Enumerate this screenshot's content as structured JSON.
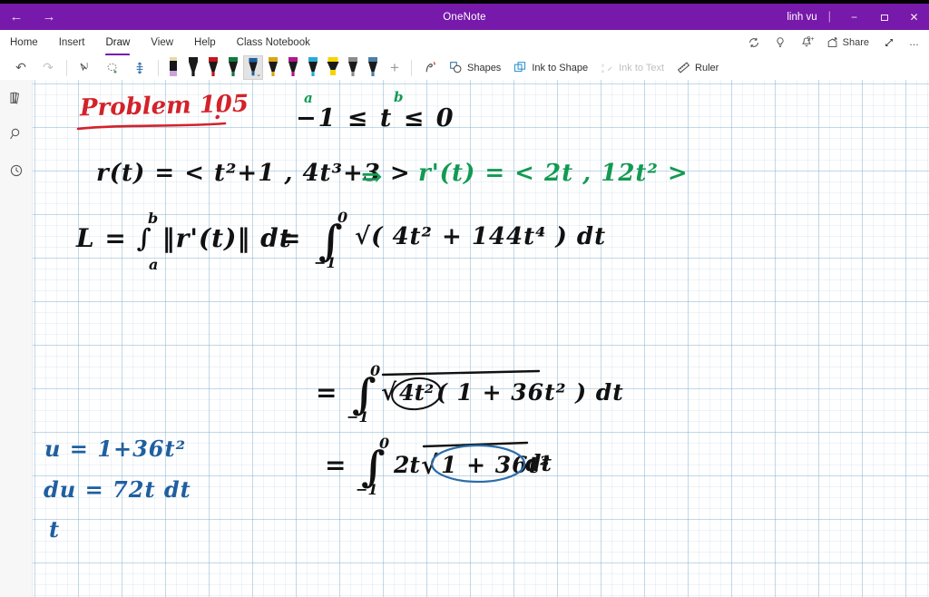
{
  "window": {
    "title": "OneNote",
    "user": "linh vu",
    "back_label": "←",
    "forward_label": "→",
    "minimize_label": "−",
    "restore_label": "❐",
    "close_label": "✕",
    "accent_color": "#7719AA"
  },
  "menu": {
    "items": [
      {
        "label": "Home",
        "active": false
      },
      {
        "label": "Insert",
        "active": false
      },
      {
        "label": "Draw",
        "active": true
      },
      {
        "label": "View",
        "active": false
      },
      {
        "label": "Help",
        "active": false
      },
      {
        "label": "Class Notebook",
        "active": false
      }
    ],
    "right_items": [
      {
        "name": "sync-icon",
        "label": ""
      },
      {
        "name": "tell-me-lightbulb-icon",
        "label": ""
      },
      {
        "name": "notifications-bell-icon",
        "label": "",
        "badge": "9+"
      },
      {
        "name": "share-icon",
        "label": "Share"
      },
      {
        "name": "full-screen-icon",
        "label": ""
      },
      {
        "name": "more-options-icon",
        "label": "…"
      }
    ]
  },
  "ribbon": {
    "undo_label": "↶",
    "redo_label": "↷",
    "tools": [
      {
        "name": "text-select-tool",
        "label": ""
      },
      {
        "name": "lasso-select-tool",
        "label": ""
      },
      {
        "name": "panning-hand-tool",
        "label": ""
      }
    ],
    "pens": [
      {
        "name": "pen-eraser-lavender",
        "color": "#cba3d8",
        "cap": "#e8d8a8",
        "type": "eraser",
        "selected": false
      },
      {
        "name": "pen-black",
        "color": "#1a1a1a",
        "cap": "#1a1a1a",
        "type": "pen",
        "selected": false
      },
      {
        "name": "pen-red",
        "color": "#c4161c",
        "cap": "#c4161c",
        "type": "pen",
        "selected": false
      },
      {
        "name": "pen-green",
        "color": "#0e7a3c",
        "cap": "#0e7a3c",
        "type": "pen",
        "selected": false
      },
      {
        "name": "pen-blue",
        "color": "#1f5fa0",
        "cap": "#1f5fa0",
        "type": "pen",
        "selected": true
      },
      {
        "name": "pen-gold",
        "color": "#d9a514",
        "cap": "#d9a514",
        "type": "pen",
        "selected": false
      },
      {
        "name": "pen-magenta",
        "color": "#b0168e",
        "cap": "#b0168e",
        "type": "pen",
        "selected": false
      },
      {
        "name": "pen-cyan",
        "color": "#2aa9dd",
        "cap": "#2aa9dd",
        "type": "pen",
        "selected": false
      },
      {
        "name": "highlighter-yellow",
        "color": "#f5d500",
        "cap": "#f5d500",
        "type": "highlighter",
        "selected": false
      },
      {
        "name": "pen-gray",
        "color": "#8c8c8c",
        "cap": "#8c8c8c",
        "type": "pen",
        "selected": false
      },
      {
        "name": "highlighter-steel-blue",
        "color": "#4b7fa6",
        "cap": "#4b7fa6",
        "type": "highlighter",
        "selected": false
      }
    ],
    "add_pen_label": "+",
    "actions": [
      {
        "name": "ink-replay-button",
        "label": "",
        "disabled": false
      },
      {
        "name": "shapes-button",
        "label": "Shapes",
        "disabled": false
      },
      {
        "name": "ink-to-shape-button",
        "label": "Ink to Shape",
        "disabled": false
      },
      {
        "name": "ink-to-text-button",
        "label": "Ink to Text",
        "disabled": true
      },
      {
        "name": "ruler-button",
        "label": "Ruler",
        "disabled": false
      }
    ]
  },
  "rail": {
    "items": [
      {
        "name": "notebooks-icon",
        "label": ""
      },
      {
        "name": "search-icon",
        "label": ""
      },
      {
        "name": "recent-notes-clock-icon",
        "label": ""
      }
    ]
  },
  "notes": {
    "title": "Problem 105",
    "title_colon": ":",
    "bounds_a_label": "a",
    "bounds_b_label": "b",
    "bounds": "−1 ≤ t ≤ 0",
    "vector_function": "r(t) = < t²+1 , 4t³+3 >",
    "implies": "⇒",
    "derivative": "r'(t) = < 2t , 12t² >",
    "arc_length_lhs": "L = ∫ ‖r'(t)‖ dt",
    "limit_b": "b",
    "limit_a": "a",
    "arc_length_rhs_eq": "=",
    "integral1_upper": "0",
    "integral1_lower": "−1",
    "integrand1": "√( 4t² + 144t⁴ ) dt",
    "line3_eq": "=",
    "integral2_upper": "0",
    "integral2_lower": "−1",
    "integrand2_a": "4t²",
    "integrand2_b": "( 1 + 36t² ) dt",
    "line4_eq": "=",
    "integral3_upper": "0",
    "integral3_lower": "−1",
    "integrand3_pre": "2t",
    "integrand3_circled": "1 + 36t²",
    "integrand3_post": "dt",
    "usub_u": "u = 1+36t²",
    "usub_du": "du = 72t dt",
    "usub_t": "t",
    "color_red": "#d3222a",
    "color_green": "#129a52",
    "color_black": "#111111",
    "color_blue": "#1f5fa0"
  }
}
